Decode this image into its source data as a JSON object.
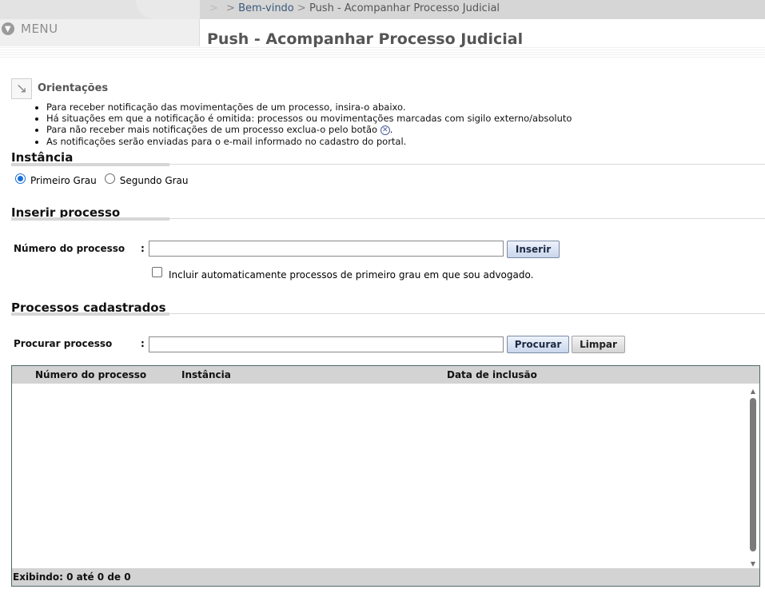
{
  "header": {
    "breadcrumb_sep_faint": ">",
    "breadcrumb_sep1": ">",
    "breadcrumb_home": "Bem-vindo",
    "breadcrumb_sep2": ">",
    "breadcrumb_current": "Push - Acompanhar Processo Judicial",
    "menu_label": "MENU",
    "page_title": "Push - Acompanhar Processo Judicial"
  },
  "orientacoes": {
    "title": "Orientações",
    "items": [
      "Para receber notificação das movimentações de um processo, insira-o abaixo.",
      "Há situações em que a notificação é omitida: processos ou movimentações marcadas com sigilo externo/absoluto",
      "Para não receber mais notificações de um processo exclua-o pelo botão",
      "As notificações serão enviadas para o e-mail informado no cadastro do portal."
    ],
    "item3_suffix": "."
  },
  "instancia": {
    "title": "Instância",
    "options": [
      "Primeiro Grau",
      "Segundo Grau"
    ],
    "selected": "Primeiro Grau"
  },
  "inserir": {
    "title": "Inserir processo",
    "label": "Número do processo",
    "colon": ":",
    "value": "",
    "button": "Inserir",
    "checkbox_label": "Incluir automaticamente processos de primeiro grau em que sou advogado.",
    "checkbox_checked": false
  },
  "cadastrados": {
    "title": "Processos cadastrados",
    "search_label": "Procurar processo",
    "colon": ":",
    "search_value": "",
    "search_button": "Procurar",
    "clear_button": "Limpar"
  },
  "table": {
    "columns": [
      "Número do processo",
      "Instância",
      "Data de inclusão"
    ],
    "rows": [],
    "footer": "Exibindo: 0 até 0 de 0"
  }
}
